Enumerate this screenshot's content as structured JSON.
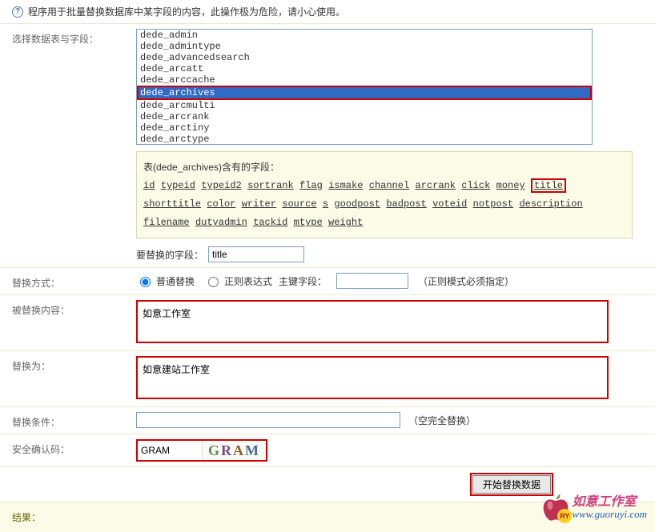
{
  "header": {
    "warning": "程序用于批量替换数据库中某字段的内容，此操作极为危险，请小心使用。"
  },
  "table_select": {
    "label": "选择数据表与字段：",
    "options": [
      "dede_admin",
      "dede_admintype",
      "dede_advancedsearch",
      "dede_arcatt",
      "dede_arccache",
      "dede_archives",
      "dede_arcmulti",
      "dede_arcrank",
      "dede_arctiny",
      "dede_arctype"
    ],
    "selected": "dede_archives"
  },
  "fields_box": {
    "title": "表(dede_archives)含有的字段：",
    "fields": [
      "id",
      "typeid",
      "typeid2",
      "sortrank",
      "flag",
      "ismake",
      "channel",
      "arcrank",
      "click",
      "money",
      "title",
      "shorttitle",
      "color",
      "writer",
      "source",
      "s",
      "goodpost",
      "badpost",
      "voteid",
      "notpost",
      "description",
      "filename",
      "dutyadmin",
      "tackid",
      "mtype",
      "weight"
    ],
    "highlighted": "title"
  },
  "replace_field": {
    "label": "要替换的字段：",
    "value": "title"
  },
  "replace_mode": {
    "label": "替换方式：",
    "opt_normal": "普通替换",
    "opt_regex": "正则表达式",
    "pk_label": "主键字段：",
    "pk_value": "",
    "hint": "（正则模式必须指定）",
    "selected": "normal"
  },
  "replaced_content": {
    "label": "被替换内容：",
    "value": "如意工作室"
  },
  "replace_to": {
    "label": "替换为：",
    "value": "如意建站工作室"
  },
  "replace_cond": {
    "label": "替换条件：",
    "value": "",
    "hint": "（空完全替换）"
  },
  "captcha": {
    "label": "安全确认码：",
    "value": "GRAM",
    "chars": [
      "G",
      "R",
      "A",
      "M"
    ]
  },
  "submit": {
    "label": "开始替换数据"
  },
  "result": {
    "label": "结果："
  },
  "watermark": {
    "name": "如意工作室",
    "url": "www.guoruyi.com",
    "badge": "RY"
  }
}
